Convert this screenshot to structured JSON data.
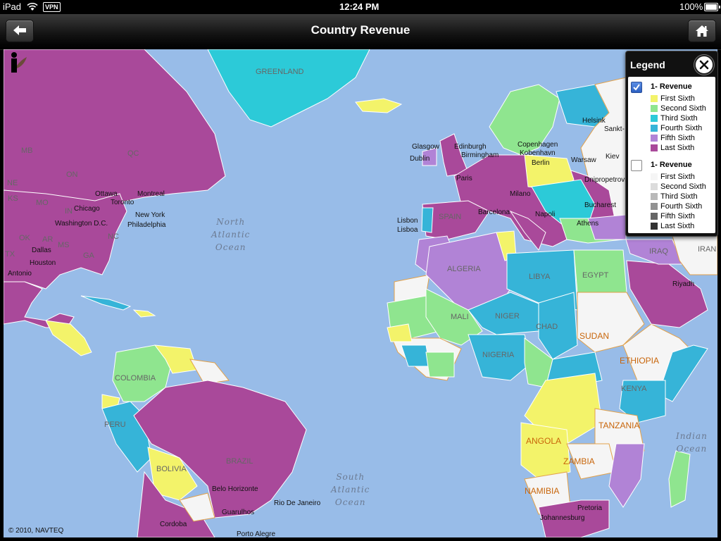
{
  "status_bar": {
    "device": "iPad",
    "vpn": "VPN",
    "time": "12:24 PM",
    "battery": "100%",
    "battery_level": 1.0
  },
  "nav": {
    "title": "Country Revenue",
    "back_icon": "back-arrow-icon",
    "home_icon": "home-icon"
  },
  "map": {
    "copyright": "© 2010, NAVTEQ",
    "ocean_color": "#98bce8",
    "oceans": {
      "north_atlantic": "North\nAtlantic\nOcean",
      "south_atlantic": "South\nAtlantic\nOcean",
      "indian": "Indian\nOcean"
    },
    "countries": {
      "greenland": "GREENLAND",
      "algeria": "ALGERIA",
      "libya": "LIBYA",
      "egypt": "EGYPT",
      "mali": "MALI",
      "niger": "NIGER",
      "chad": "CHAD",
      "sudan": "SUDAN",
      "nigeria": "NIGERIA",
      "ethiopia": "ETHIOPIA",
      "kenya": "KENYA",
      "tanzania": "TANZANIA",
      "angola": "ANGOLA",
      "zambia": "ZAMBIA",
      "namibia": "NAMIBIA",
      "colombia": "COLOMBIA",
      "peru": "PERU",
      "bolivia": "BOLIVIA",
      "brazil": "BRAZIL",
      "iraq": "IRAQ",
      "iran": "IRAN",
      "spain": "SPAIN"
    },
    "regions": {
      "mb": "MB",
      "qc": "QC",
      "on": "ON",
      "ks": "KS",
      "mo": "MO",
      "ok": "OK",
      "tx": "TX",
      "ga": "GA",
      "ar": "AR",
      "in": "IN",
      "ne": "NE",
      "ms": "MS",
      "nc": "NC"
    },
    "cities": {
      "ottawa": "Ottawa",
      "montreal": "Montreal",
      "toronto": "Toronto",
      "chicago": "Chicago",
      "washington": "Washington D.C.",
      "new_york": "New York",
      "philadelphia": "Philadelphia",
      "dallas": "Dallas",
      "houston": "Houston",
      "antonio": "Antonio",
      "glasgow": "Glasgow",
      "edinburgh": "Edinburgh",
      "dublin": "Dublin",
      "birmingham": "Birmingham",
      "paris": "Paris",
      "milano": "Milano",
      "barcelona": "Barcelona",
      "napoli": "Napoli",
      "lisbon": "Lisbon",
      "lisboa": "Lisboa",
      "copenhagen": "Copenhagen",
      "kobenhavn": "Kobenhavn",
      "berlin": "Berlin",
      "warsaw": "Warsaw",
      "kiev": "Kiev",
      "helsinki": "Helsink",
      "sankt": "Sankt-",
      "bucharest": "Bucharest",
      "athens": "Athens",
      "dnipro": "Dnipropetrovsk",
      "riyadh": "Riyadh",
      "belo_horizonte": "Belo Horizonte",
      "rio": "Rio De Janeiro",
      "guarulhos": "Guarulhos",
      "porto_alegre": "Porto Alegre",
      "cordoba": "Cordoba",
      "pretoria": "Pretoria",
      "johannesburg": "Johannesburg"
    }
  },
  "legend": {
    "title": "Legend",
    "close_icon": "close-icon",
    "groups": [
      {
        "title": "1- Revenue",
        "checked": true,
        "items": [
          {
            "label": "First Sixth",
            "color": "#f3f36a"
          },
          {
            "label": "Second Sixth",
            "color": "#8fe58f"
          },
          {
            "label": "Third Sixth",
            "color": "#2ccad8"
          },
          {
            "label": "Fourth Sixth",
            "color": "#36b4d8"
          },
          {
            "label": "Fifth Sixth",
            "color": "#b183d6"
          },
          {
            "label": "Last Sixth",
            "color": "#a9499a"
          }
        ]
      },
      {
        "title": "1- Revenue",
        "checked": false,
        "items": [
          {
            "label": "First Sixth",
            "color": "#f5f5f5"
          },
          {
            "label": "Second Sixth",
            "color": "#dcdcdc"
          },
          {
            "label": "Third Sixth",
            "color": "#b9b9b9"
          },
          {
            "label": "Fourth Sixth",
            "color": "#929292"
          },
          {
            "label": "Fifth Sixth",
            "color": "#666666"
          },
          {
            "label": "Last Sixth",
            "color": "#333333"
          }
        ]
      }
    ]
  }
}
